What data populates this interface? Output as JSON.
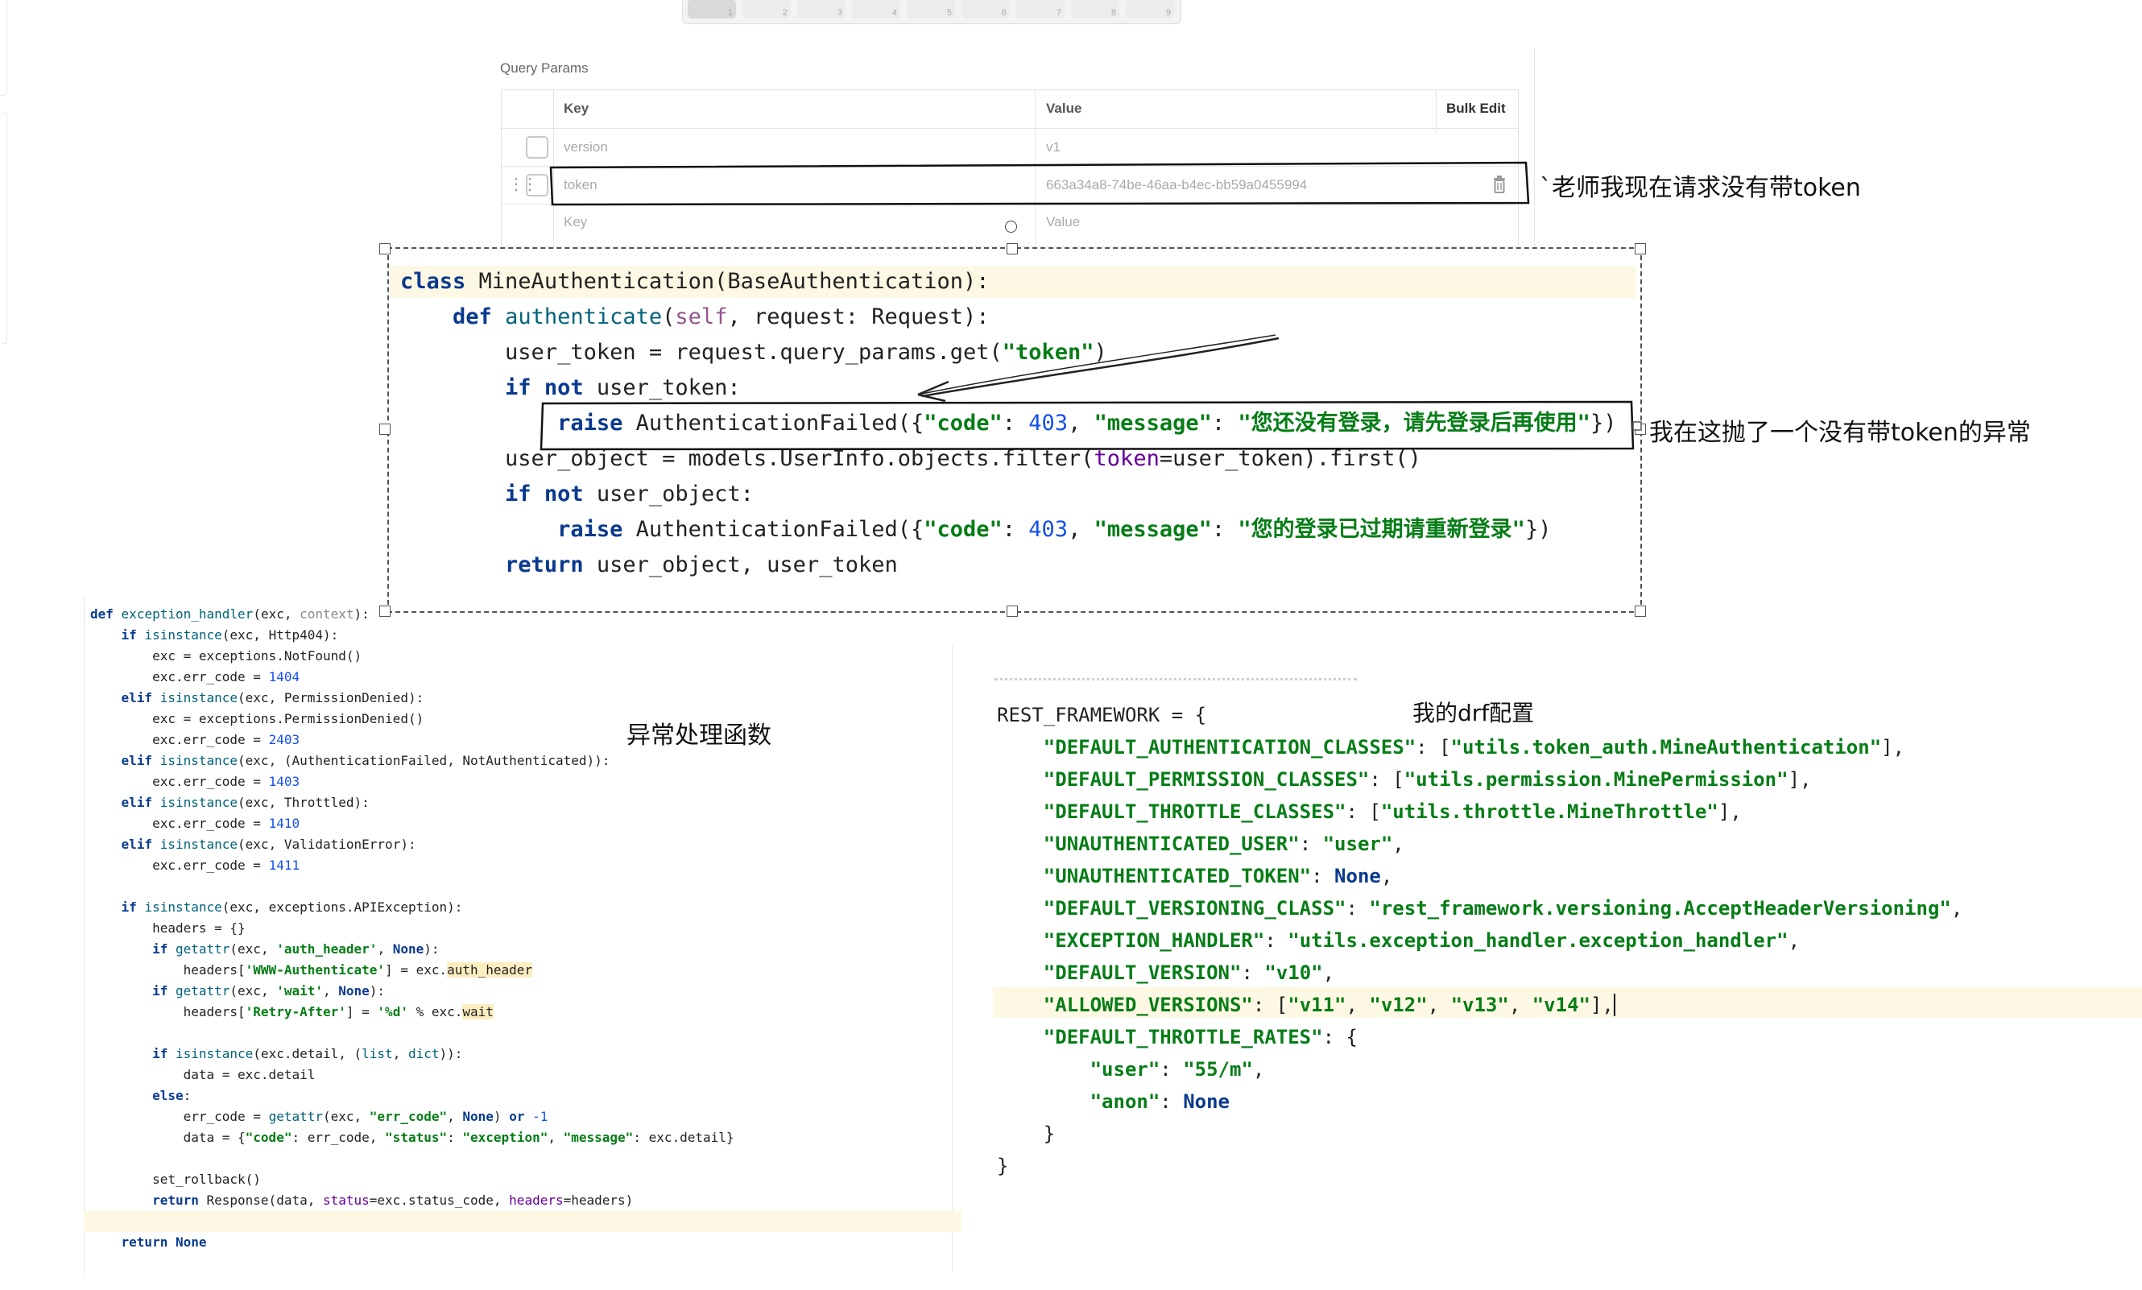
{
  "toolbar": {
    "buttons": [
      "1",
      "2",
      "3",
      "4",
      "5",
      "6",
      "7",
      "8",
      "9"
    ]
  },
  "query_params": {
    "title": "Query Params",
    "headers": {
      "key": "Key",
      "value": "Value",
      "bulk_edit": "Bulk Edit"
    },
    "rows": [
      {
        "key": "version",
        "value": "v1"
      },
      {
        "key": "token",
        "value": "663a34a8-74be-46aa-b4ec-bb59a0455994"
      }
    ],
    "new_row": {
      "key_placeholder": "Key",
      "value_placeholder": "Value"
    }
  },
  "annotations": {
    "no_token": "`老师我现在请求没有带token",
    "raised": "我在这抛了一个没有带token的异常",
    "handler": "异常处理函数",
    "drf": "我的drf配置"
  },
  "auth_code": [
    "class MineAuthentication(BaseAuthentication):",
    "    def authenticate(self, request: Request):",
    "        user_token = request.query_params.get(\"token\")",
    "        if not user_token:",
    "            raise AuthenticationFailed({\"code\": 403, \"message\": \"您还没有登录，请先登录后再使用\"})",
    "        user_object = models.UserInfo.objects.filter(token=user_token).first()",
    "        if not user_object:",
    "            raise AuthenticationFailed({\"code\": 403, \"message\": \"您的登录已过期请重新登录\"})",
    "        return user_object, user_token"
  ],
  "handler_code": [
    "def exception_handler(exc, context):",
    "    if isinstance(exc, Http404):",
    "        exc = exceptions.NotFound()",
    "        exc.err_code = 1404",
    "    elif isinstance(exc, PermissionDenied):",
    "        exc = exceptions.PermissionDenied()",
    "        exc.err_code = 2403",
    "    elif isinstance(exc, (AuthenticationFailed, NotAuthenticated)):",
    "        exc.err_code = 1403",
    "    elif isinstance(exc, Throttled):",
    "        exc.err_code = 1410",
    "    elif isinstance(exc, ValidationError):",
    "        exc.err_code = 1411",
    "",
    "    if isinstance(exc, exceptions.APIException):",
    "        headers = {}",
    "        if getattr(exc, 'auth_header', None):",
    "            headers['WWW-Authenticate'] = exc.auth_header",
    "        if getattr(exc, 'wait', None):",
    "            headers['Retry-After'] = '%d' % exc.wait",
    "",
    "        if isinstance(exc.detail, (list, dict)):",
    "            data = exc.detail",
    "        else:",
    "            err_code = getattr(exc, \"err_code\", None) or -1",
    "            data = {\"code\": err_code, \"status\": \"exception\", \"message\": exc.detail}",
    "",
    "        set_rollback()",
    "        return Response(data, status=exc.status_code, headers=headers)",
    "",
    "    return None"
  ],
  "drf_code": [
    "REST_FRAMEWORK = {",
    "    \"DEFAULT_AUTHENTICATION_CLASSES\": [\"utils.token_auth.MineAuthentication\"],",
    "    \"DEFAULT_PERMISSION_CLASSES\": [\"utils.permission.MinePermission\"],",
    "    \"DEFAULT_THROTTLE_CLASSES\": [\"utils.throttle.MineThrottle\"],",
    "    \"UNAUTHENTICATED_USER\": \"user\",",
    "    \"UNAUTHENTICATED_TOKEN\": None,",
    "    \"DEFAULT_VERSIONING_CLASS\": \"rest_framework.versioning.AcceptHeaderVersioning\",",
    "    \"EXCEPTION_HANDLER\": \"utils.exception_handler.exception_handler\",",
    "    \"DEFAULT_VERSION\": \"v10\",",
    "    \"ALLOWED_VERSIONS\": [\"v11\", \"v12\", \"v13\", \"v14\"],",
    "    \"DEFAULT_THROTTLE_RATES\": {",
    "        \"user\": \"55/m\",",
    "        \"anon\": None",
    "    }",
    "}"
  ],
  "colors": {
    "keyword": "#0a3a8f",
    "string": "#067d17",
    "number": "#1750eb",
    "highlight": "#fdf8e3"
  }
}
